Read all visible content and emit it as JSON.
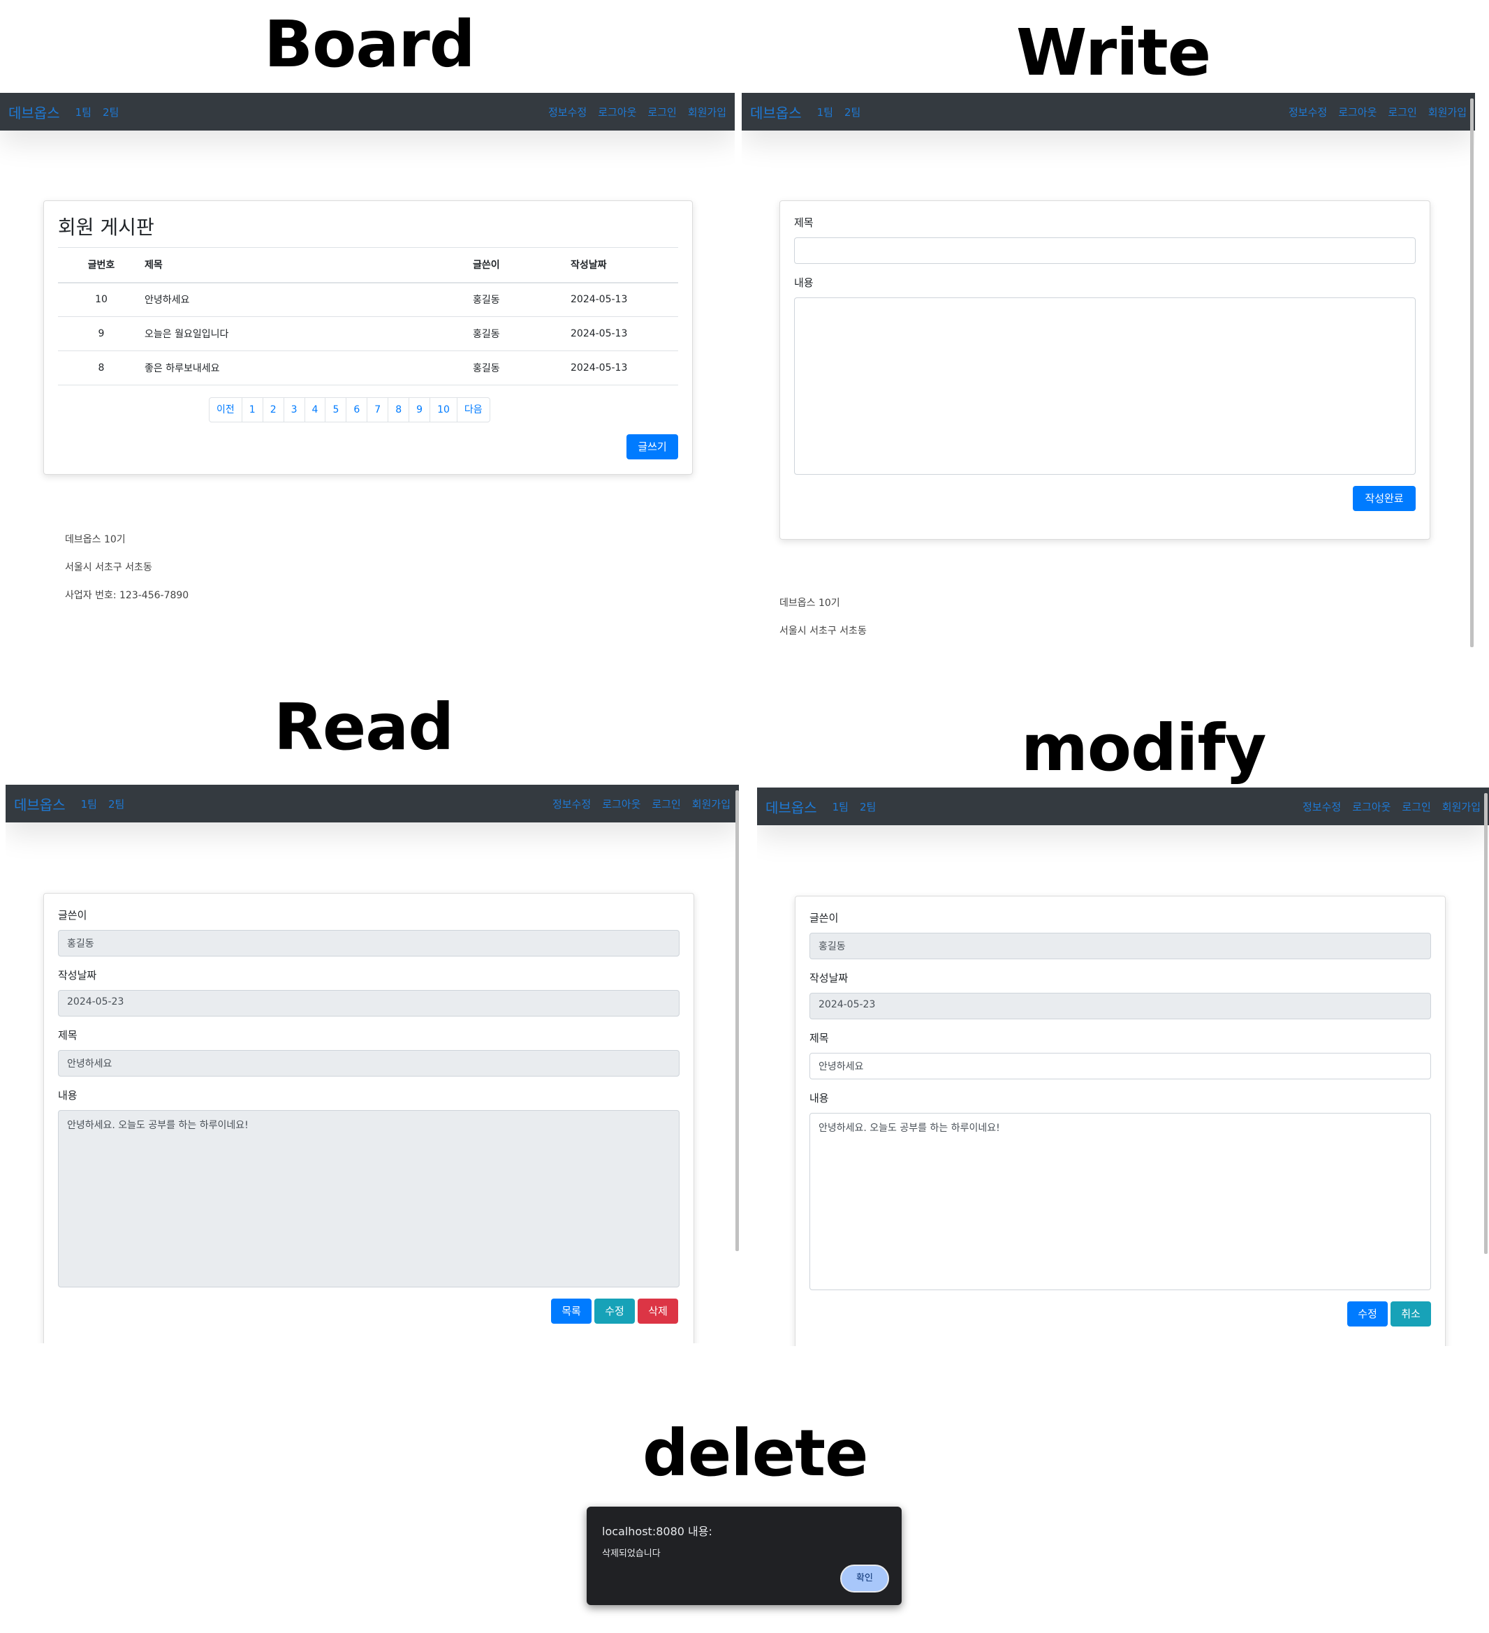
{
  "headings": {
    "board": "Board",
    "write": "Write",
    "read": "Read",
    "modify": "modify",
    "delete": "delete"
  },
  "nav": {
    "brand": "데브옵스",
    "left_links": [
      "1팀",
      "2팀"
    ],
    "right_links": [
      "정보수정",
      "로그아웃",
      "로그인",
      "회원가입"
    ]
  },
  "board": {
    "title": "회원 게시판",
    "columns": [
      "글번호",
      "제목",
      "글쓴이",
      "작성날짜"
    ],
    "rows": [
      [
        "10",
        "안녕하세요",
        "홍길동",
        "2024-05-13"
      ],
      [
        "9",
        "오늘은 월요일입니다",
        "홍길동",
        "2024-05-13"
      ],
      [
        "8",
        "좋은 하루보내세요",
        "홍길동",
        "2024-05-13"
      ]
    ],
    "pagination": [
      "이전",
      "1",
      "2",
      "3",
      "4",
      "5",
      "6",
      "7",
      "8",
      "9",
      "10",
      "다음"
    ],
    "write_button": "글쓰기",
    "footer": [
      "데브옵스 10기",
      "서울시 서초구 서초동",
      "사업자 번호: 123-456-7890"
    ]
  },
  "write": {
    "title_label": "제목",
    "content_label": "내용",
    "submit_button": "작성완료",
    "footer": [
      "데브옵스 10기",
      "서울시 서초구 서초동"
    ]
  },
  "read": {
    "writer_label": "글쓴이",
    "writer_value": "홍길동",
    "date_label": "작성날짜",
    "date_value": "2024-05-23",
    "title_label": "제목",
    "title_value": "안녕하세요",
    "content_label": "내용",
    "content_value": "안녕하세요. 오늘도 공부를 하는 하루이네요!",
    "buttons": {
      "list": "목록",
      "modify": "수정",
      "delete": "삭제"
    }
  },
  "modify": {
    "writer_label": "글쓴이",
    "writer_value": "홍길동",
    "date_label": "작성날짜",
    "date_value": "2024-05-23",
    "title_label": "제목",
    "title_value": "안녕하세요",
    "content_label": "내용",
    "content_value": "안녕하세요. 오늘도 공부를 하는 하루이네요!",
    "buttons": {
      "submit": "수정",
      "cancel": "취소"
    }
  },
  "dialog": {
    "title": "localhost:8080 내용:",
    "message": "삭제되었습니다",
    "ok_button": "확인"
  },
  "colors": {
    "navbar": "#343a40",
    "link": "#1e7ad6",
    "primary": "#007bff",
    "info": "#17a2b8",
    "danger": "#dc3545",
    "dialog": "#202124"
  }
}
